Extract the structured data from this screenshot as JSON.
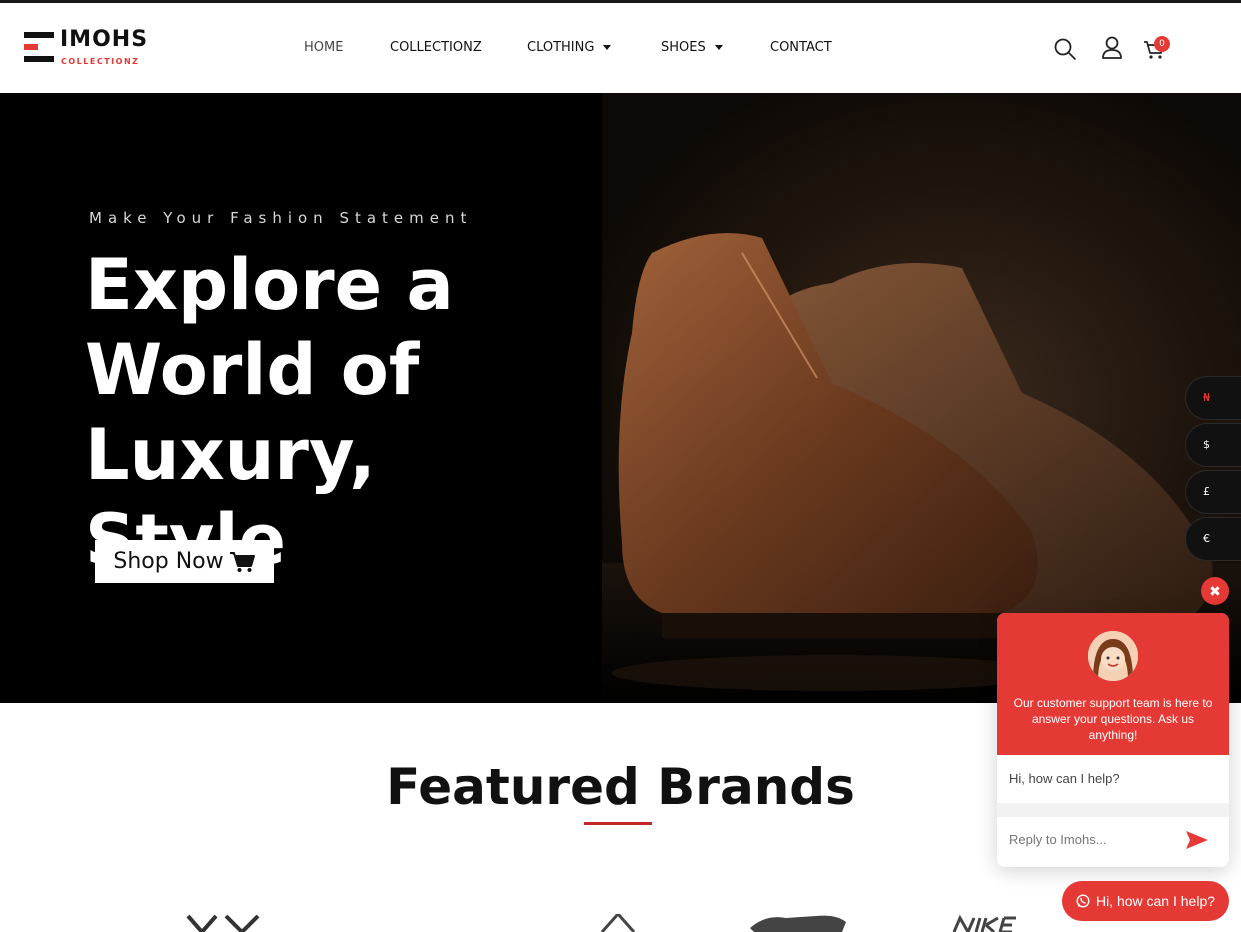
{
  "brand": {
    "name": "IMOHS",
    "sub": "COLLECTIONZ"
  },
  "nav": {
    "home": "HOME",
    "collectionz": "COLLECTIONZ",
    "clothing": "CLOTHING",
    "shoes": "SHOES",
    "contact": "CONTACT"
  },
  "header": {
    "cart_count": "0",
    "icons": [
      "search-icon",
      "user-icon",
      "cart-icon"
    ]
  },
  "hero": {
    "tagline": "Make Your Fashion Statement",
    "title": "Explore a World of Luxury, Style",
    "cta_label": "Shop Now"
  },
  "currency": {
    "options": [
      "₦",
      "$",
      "£",
      "€"
    ],
    "selected": "₦"
  },
  "featured": {
    "title": "Featured Brands"
  },
  "chat": {
    "intro": "Our customer support team is here to answer your questions. Ask us anything!",
    "greeting": "Hi, how can I help?",
    "input_placeholder": "Reply to Imohs...",
    "launcher_label": "Hi, how can I help?"
  },
  "colors": {
    "accent": "#e53935",
    "dark": "#111111",
    "hero_bg": "#000000"
  }
}
